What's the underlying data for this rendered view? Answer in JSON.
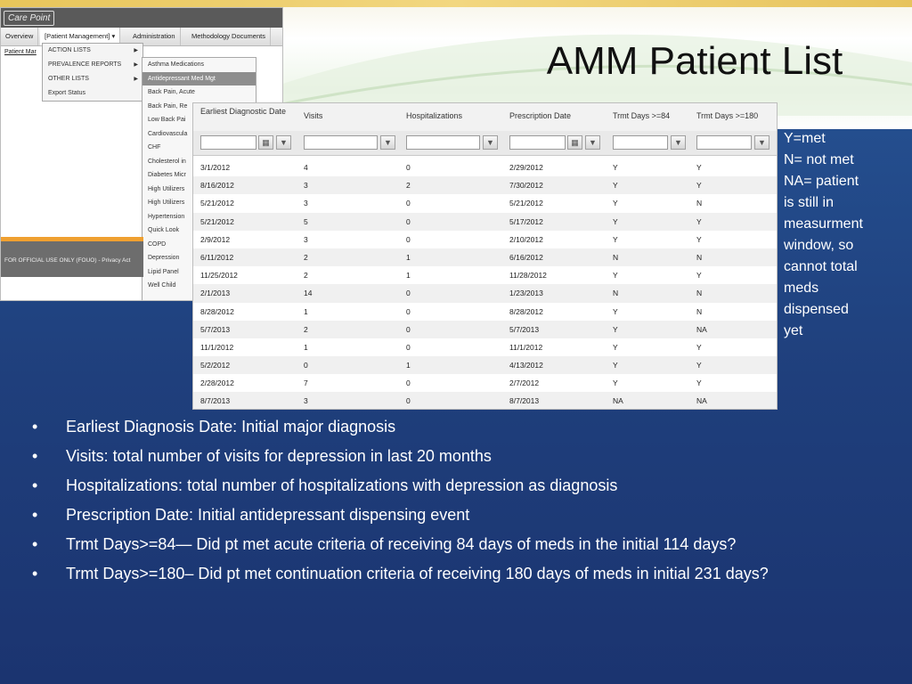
{
  "slide": {
    "title": "AMM Patient List"
  },
  "app": {
    "logo": "Care Point",
    "nav": [
      "Overview",
      "[Patient Management] ▾",
      "Administration",
      "Methodology Documents"
    ],
    "sub_link": "Patient Mar",
    "menu1": [
      "ACTION LISTS",
      "PREVALENCE REPORTS",
      "OTHER LISTS",
      "Export Status"
    ],
    "menu2": [
      "Asthma Medications",
      "Antidepressant Med Mgt",
      "Back Pain, Acute",
      "Back Pain, Re",
      "Low Back Pai",
      "Cardiovascula",
      "CHF",
      "Cholesterol in",
      "Diabetes Micr",
      "High Utilizers",
      "High Utilizers",
      "Hypertension",
      "Quick Look",
      "COPD",
      "Depression",
      "Lipid Panel",
      "Well Child"
    ],
    "footer": "FOR OFFICIAL USE ONLY (FOUO) - Privacy Act"
  },
  "grid": {
    "columns": [
      "Earliest Diagnostic Date",
      "Visits",
      "Hospitalizations",
      "Prescription Date",
      "Trmt Days >=84",
      "Trmt Days >=180"
    ],
    "rows": [
      [
        "3/1/2012",
        "4",
        "0",
        "2/29/2012",
        "Y",
        "Y"
      ],
      [
        "8/16/2012",
        "3",
        "2",
        "7/30/2012",
        "Y",
        "Y"
      ],
      [
        "5/21/2012",
        "3",
        "0",
        "5/21/2012",
        "Y",
        "N"
      ],
      [
        "5/21/2012",
        "5",
        "0",
        "5/17/2012",
        "Y",
        "Y"
      ],
      [
        "2/9/2012",
        "3",
        "0",
        "2/10/2012",
        "Y",
        "Y"
      ],
      [
        "6/11/2012",
        "2",
        "1",
        "6/16/2012",
        "N",
        "N"
      ],
      [
        "11/25/2012",
        "2",
        "1",
        "11/28/2012",
        "Y",
        "Y"
      ],
      [
        "2/1/2013",
        "14",
        "0",
        "1/23/2013",
        "N",
        "N"
      ],
      [
        "8/28/2012",
        "1",
        "0",
        "8/28/2012",
        "Y",
        "N"
      ],
      [
        "5/7/2013",
        "2",
        "0",
        "5/7/2013",
        "Y",
        "NA"
      ],
      [
        "11/1/2012",
        "1",
        "0",
        "11/1/2012",
        "Y",
        "Y"
      ],
      [
        "5/2/2012",
        "0",
        "1",
        "4/13/2012",
        "Y",
        "Y"
      ],
      [
        "2/28/2012",
        "7",
        "0",
        "2/7/2012",
        "Y",
        "Y"
      ],
      [
        "8/7/2013",
        "3",
        "0",
        "8/7/2013",
        "NA",
        "NA"
      ]
    ]
  },
  "legend": [
    "Y=met",
    "N= not met",
    "NA= patient",
    "is still in",
    "measurment",
    "window, so",
    "cannot total",
    "meds",
    "dispensed",
    "yet"
  ],
  "bullets": [
    "Earliest Diagnosis Date:  Initial major diagnosis",
    "Visits:  total number of visits for depression in last 20 months",
    "Hospitalizations: total number of hospitalizations with depression as diagnosis",
    "Prescription Date:  Initial antidepressant dispensing event",
    "Trmt Days>=84— Did pt met acute criteria of receiving 84 days of meds in the initial 114 days?",
    "Trmt Days>=180– Did pt met continuation criteria of receiving 180 days of meds in initial 231 days?"
  ]
}
